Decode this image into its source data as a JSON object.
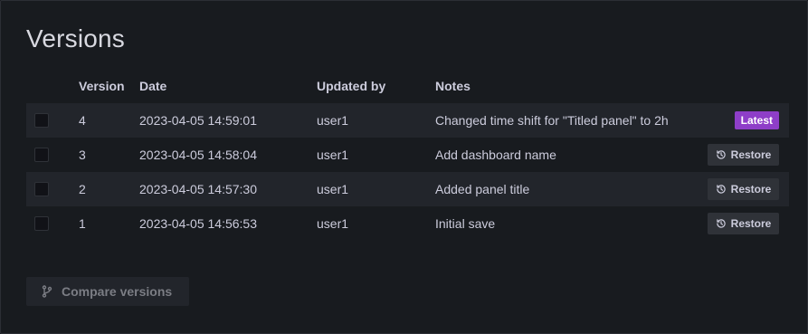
{
  "title": "Versions",
  "columns": {
    "version": "Version",
    "date": "Date",
    "updated_by": "Updated by",
    "notes": "Notes"
  },
  "rows": [
    {
      "version": "4",
      "date": "2023-04-05 14:59:01",
      "user": "user1",
      "notes": "Changed time shift for \"Titled panel\" to 2h",
      "badge": "Latest"
    },
    {
      "version": "3",
      "date": "2023-04-05 14:58:04",
      "user": "user1",
      "notes": "Add dashboard name",
      "action": "Restore"
    },
    {
      "version": "2",
      "date": "2023-04-05 14:57:30",
      "user": "user1",
      "notes": "Added panel title",
      "action": "Restore"
    },
    {
      "version": "1",
      "date": "2023-04-05 14:56:53",
      "user": "user1",
      "notes": "Initial save",
      "action": "Restore"
    }
  ],
  "compare_button": "Compare versions",
  "colors": {
    "latest_badge": "#8e3ec8",
    "panel_bg": "#181b1f",
    "row_alt_bg": "#22252b"
  },
  "icons": {
    "restore": "history-icon",
    "compare": "code-branch-icon"
  }
}
